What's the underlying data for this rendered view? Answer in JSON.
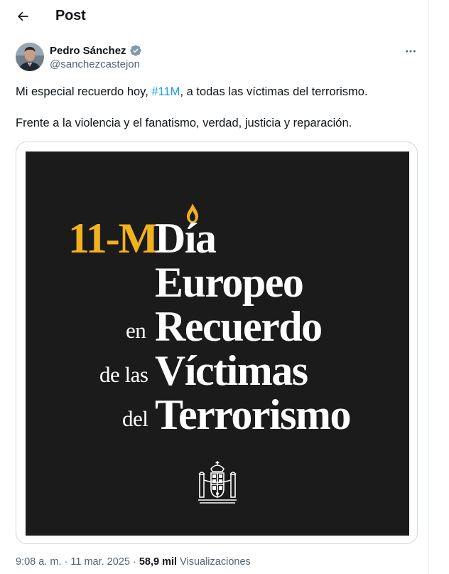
{
  "header": {
    "title": "Post"
  },
  "author": {
    "name": "Pedro Sánchez",
    "handle": "@sanchezcastejon"
  },
  "post": {
    "line1_before": "Mi especial recuerdo hoy, ",
    "hashtag": "#11M",
    "line1_after": ", a todas las víctimas del terrorismo.",
    "line2": "Frente a la violencia y el fanatismo, verdad, justicia y reparación."
  },
  "image": {
    "gold_text": "11-M",
    "dia": "Día",
    "europeo": "Europeo",
    "en": "en",
    "recuerdo": "Recuerdo",
    "de_las": "de las",
    "victimas": "Víctimas",
    "del": "del",
    "terrorismo": "Terrorismo"
  },
  "meta": {
    "time": "9:08 a. m.",
    "separator1": " · ",
    "date": "11 mar. 2025",
    "separator2": " · ",
    "views_count": "58,9 mil",
    "views_label": " Visualizaciones"
  },
  "colors": {
    "accent": "#1d9bf0",
    "gold": "#f2b21e",
    "image_bg": "#1b1b1b",
    "secondary_text": "#536471"
  },
  "icons": {
    "back": "arrow-left-icon",
    "verified": "verified-badge-icon",
    "more": "more-horizontal-icon"
  }
}
